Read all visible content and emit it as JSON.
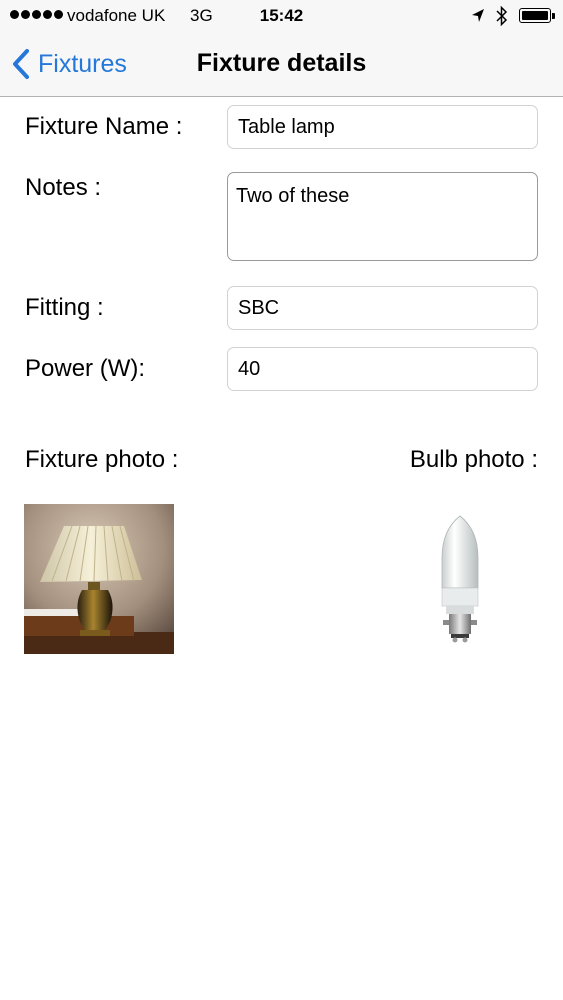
{
  "status_bar": {
    "carrier": "vodafone UK",
    "network": "3G",
    "time": "15:42",
    "icons": [
      "location-arrow-icon",
      "bluetooth-icon",
      "battery-icon"
    ]
  },
  "nav": {
    "back_label": "Fixtures",
    "title": "Fixture details"
  },
  "form": {
    "name_label": "Fixture Name :",
    "name_value": "Table lamp",
    "notes_label": "Notes :",
    "notes_value": "Two of these",
    "fitting_label": "Fitting :",
    "fitting_value": "SBC",
    "power_label": "Power (W):",
    "power_value": "40"
  },
  "photos": {
    "fixture_label": "Fixture photo :",
    "bulb_label": "Bulb photo :"
  },
  "colors": {
    "accent": "#2578d8",
    "bar_background": "#f7f7f7"
  }
}
